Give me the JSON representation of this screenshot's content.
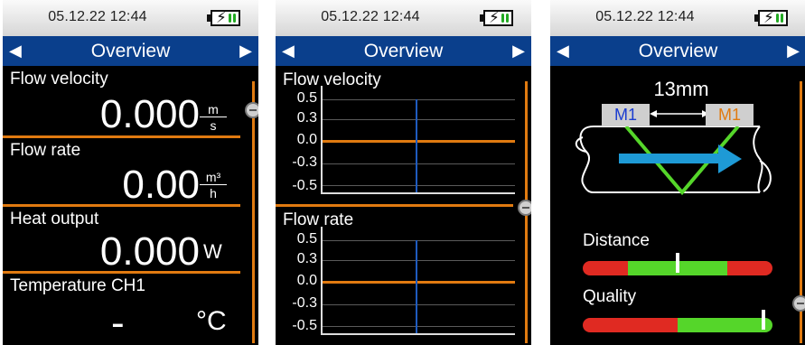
{
  "status": {
    "datetime": "05.12.22  12:44",
    "battery_icon": "battery-charging-icon"
  },
  "colors": {
    "accent": "#e07a10",
    "titlebar": "#0a3f8c",
    "m1_left": "#1a3cd0",
    "m1_right": "#e07a10",
    "flow_arrow": "#1e9ad6",
    "sound_path": "#55d62a"
  },
  "screens": [
    {
      "title": "Overview",
      "readings": [
        {
          "label": "Flow velocity",
          "value": "0.000",
          "unit_num": "m",
          "unit_den": "s"
        },
        {
          "label": "Flow rate",
          "value": "0.00",
          "unit_num": "m³",
          "unit_den": "h"
        },
        {
          "label": "Heat output",
          "value": "0.000",
          "unit": "W"
        },
        {
          "label": "Temperature CH1",
          "value": "-",
          "unit": "°C"
        }
      ]
    },
    {
      "title": "Overview",
      "charts": [
        {
          "label": "Flow velocity",
          "ticks": [
            "0.5",
            "0.3",
            "0.0",
            "-0.3",
            "-0.5"
          ]
        },
        {
          "label": "Flow rate",
          "ticks": [
            "0.5",
            "0.3",
            "0.0",
            "-0.3",
            "-0.5"
          ]
        }
      ]
    },
    {
      "title": "Overview",
      "sensor_distance": "13mm",
      "sensor_left": "M1",
      "sensor_right": "M1",
      "distance_label": "Distance",
      "quality_label": "Quality",
      "distance_marker_fraction": 0.5,
      "quality_marker_fraction": 0.95
    }
  ]
}
